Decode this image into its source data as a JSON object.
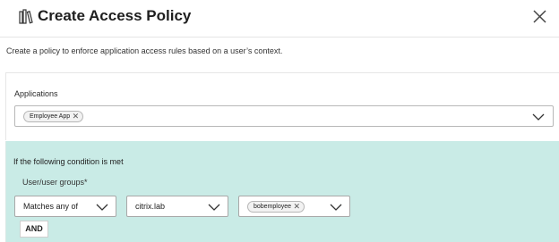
{
  "dialog": {
    "title": "Create Access Policy",
    "description": "Create a policy to enforce application access rules based on a user’s context."
  },
  "applications": {
    "label": "Applications",
    "selected": [
      {
        "name": "Employee App"
      }
    ]
  },
  "condition": {
    "title": "If the following condition is met",
    "field_label": "User/user groups*",
    "match_type": "Matches any of",
    "domain": "citrix.lab",
    "users": [
      {
        "name": "bobemployee"
      }
    ],
    "and_button": "AND"
  },
  "icons": {
    "title": "books-icon",
    "close": "close-icon",
    "dropdown": "chevron-down-icon",
    "remove": "remove-chip-icon"
  },
  "colors": {
    "condition_background": "#c9ebe6"
  }
}
